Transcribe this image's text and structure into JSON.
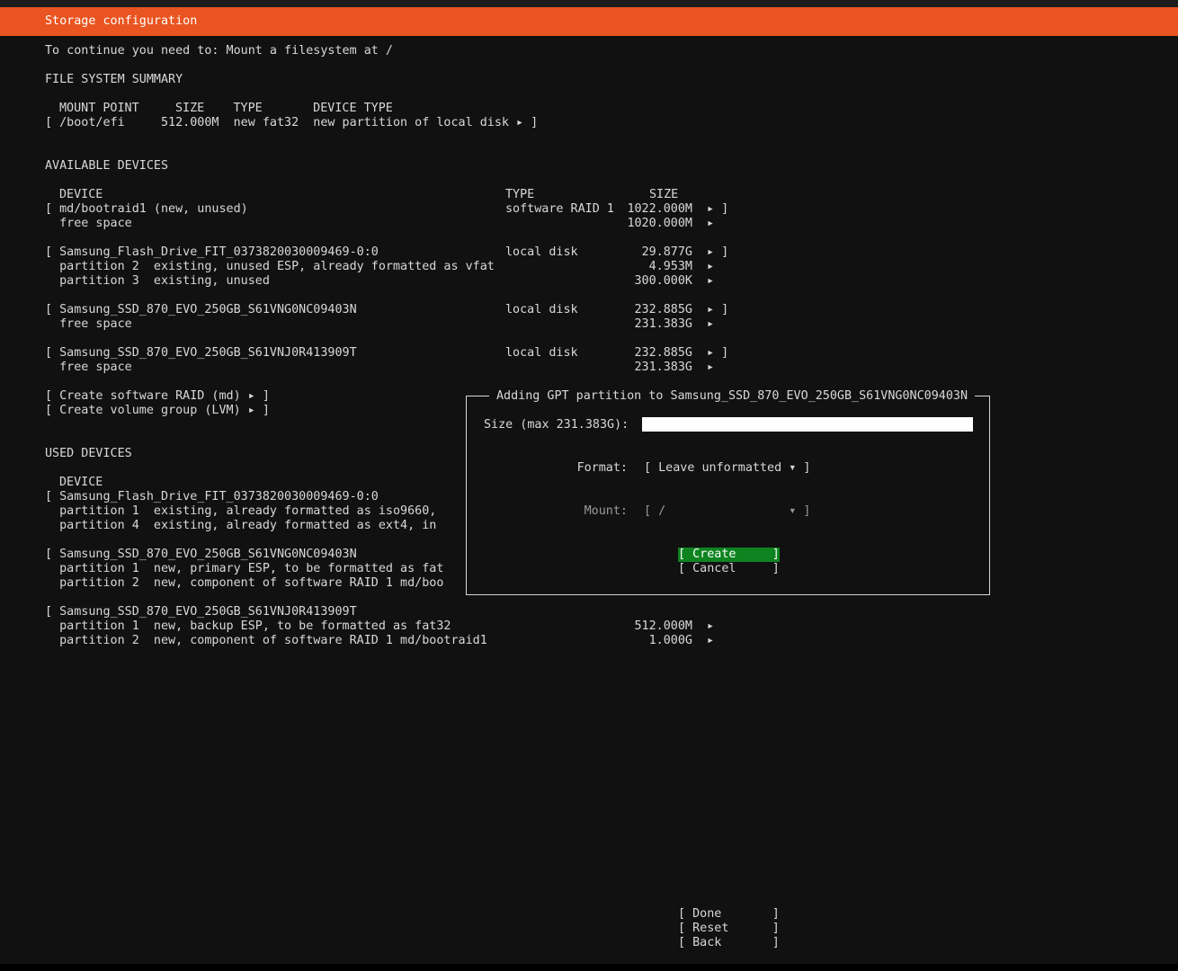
{
  "title": "Storage configuration",
  "instruction": "To continue you need to: Mount a filesystem at /",
  "fs_summary": {
    "heading": "FILE SYSTEM SUMMARY",
    "header": "MOUNT POINT     SIZE    TYPE       DEVICE TYPE",
    "row": "[ /boot/efi     512.000M  new fat32  new partition of local disk ▸ ]"
  },
  "available": {
    "heading": "AVAILABLE DEVICES",
    "header_device": "DEVICE",
    "header_type": "TYPE",
    "header_size": "SIZE",
    "lines": [
      {
        "left": "[ md/bootraid1 (new, unused)",
        "type": "software RAID 1",
        "size": "1022.000M",
        "arrow": "▸ ]"
      },
      {
        "left": "  free space",
        "type": "",
        "size": "1020.000M",
        "arrow": "▸"
      },
      {
        "left": "[ Samsung_Flash_Drive_FIT_0373820030009469-0:0",
        "type": "local disk",
        "size": "29.877G",
        "arrow": "▸ ]"
      },
      {
        "left": "  partition 2  existing, unused ESP, already formatted as vfat",
        "type": "",
        "size": "4.953M",
        "arrow": "▸"
      },
      {
        "left": "  partition 3  existing, unused",
        "type": "",
        "size": "300.000K",
        "arrow": "▸"
      },
      {
        "left": "[ Samsung_SSD_870_EVO_250GB_S61VNG0NC09403N",
        "type": "local disk",
        "size": "232.885G",
        "arrow": "▸ ]"
      },
      {
        "left": "  free space",
        "type": "",
        "size": "231.383G",
        "arrow": "▸"
      },
      {
        "left": "[ Samsung_SSD_870_EVO_250GB_S61VNJ0R413909T",
        "type": "local disk",
        "size": "232.885G",
        "arrow": "▸ ]"
      },
      {
        "left": "  free space",
        "type": "",
        "size": "231.383G",
        "arrow": "▸"
      }
    ],
    "create_raid": "[ Create software RAID (md) ▸ ]",
    "create_lvm": "[ Create volume group (LVM) ▸ ]"
  },
  "used": {
    "heading": "USED DEVICES",
    "header_device": "DEVICE",
    "lines": [
      {
        "left": "[ Samsung_Flash_Drive_FIT_0373820030009469-0:0",
        "size": "",
        "arrow": ""
      },
      {
        "left": "  partition 1  existing, already formatted as iso9660,",
        "size": "",
        "arrow": ""
      },
      {
        "left": "  partition 4  existing, already formatted as ext4, in",
        "size": "",
        "arrow": ""
      },
      {
        "left": "[ Samsung_SSD_870_EVO_250GB_S61VNG0NC09403N",
        "size": "",
        "arrow": ""
      },
      {
        "left": "  partition 1  new, primary ESP, to be formatted as fat",
        "size": "",
        "arrow": ""
      },
      {
        "left": "  partition 2  new, component of software RAID 1 md/boo",
        "size": "",
        "arrow": ""
      },
      {
        "left": "[ Samsung_SSD_870_EVO_250GB_S61VNJ0R413909T",
        "size": "",
        "arrow": ""
      },
      {
        "left": "  partition 1  new, backup ESP, to be formatted as fat32",
        "size": "512.000M",
        "arrow": "▸"
      },
      {
        "left": "  partition 2  new, component of software RAID 1 md/bootraid1",
        "size": "1.000G",
        "arrow": "▸"
      }
    ]
  },
  "dialog": {
    "title": "Adding GPT partition to Samsung_SSD_870_EVO_250GB_S61VNG0NC09403N",
    "size_label": "Size (max 231.383G):",
    "size_value": "",
    "format_label": "Format:",
    "format_value": "[ Leave unformatted ▾ ]",
    "mount_label": "Mount:",
    "mount_value": "[ /                 ▾ ]",
    "create": "[ Create     ]",
    "cancel": "[ Cancel     ]"
  },
  "footer": {
    "done": "[ Done       ]",
    "reset": "[ Reset      ]",
    "back": "[ Back       ]"
  },
  "colors": {
    "accent": "#e95420",
    "focus": "#0e8420",
    "background": "#111111"
  }
}
